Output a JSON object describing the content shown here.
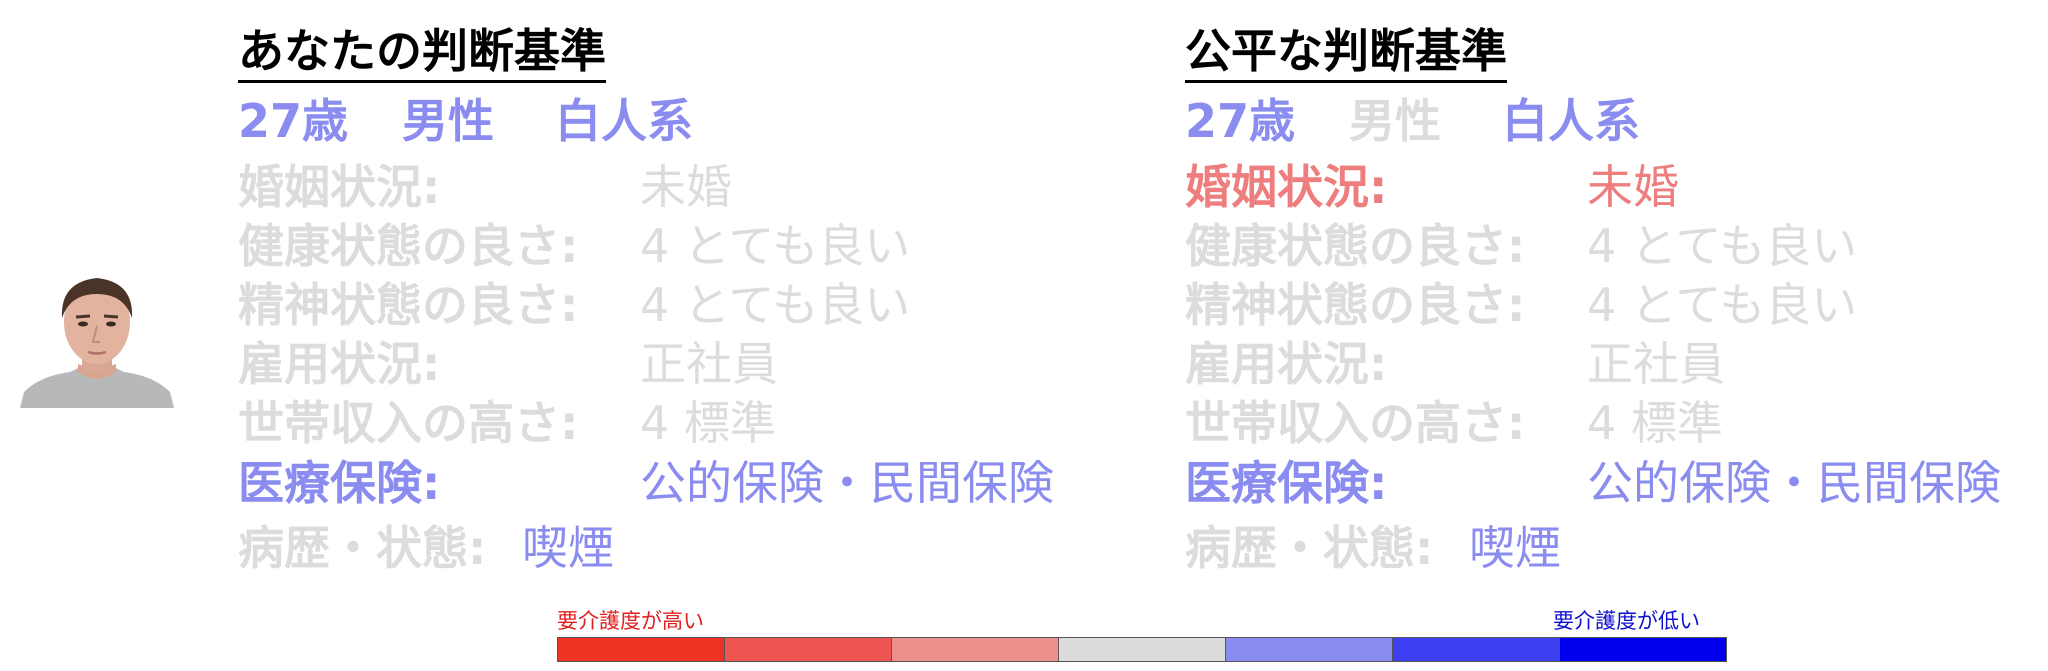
{
  "colors": {
    "highlight_blue": "#8a8cf0",
    "highlight_red": "#ee7d7d",
    "muted_gray": "#dcdcdc",
    "scale_red_label": "#e02020",
    "scale_blue_label": "#1010d0"
  },
  "left": {
    "title": "あなたの判断基準",
    "age": "27歳",
    "gender": "男性",
    "race": "白人系",
    "rows": [
      {
        "label": "婚姻状況:",
        "value": "未婚"
      },
      {
        "label": "健康状態の良さ:",
        "value": "4 とても良い"
      },
      {
        "label": "精神状態の良さ:",
        "value": "4 とても良い"
      },
      {
        "label": "雇用状況:",
        "value": "正社員"
      },
      {
        "label": "世帯収入の高さ:",
        "value": "4 標準"
      },
      {
        "label": "医療保険:",
        "value": "公的保険・民間保険"
      }
    ],
    "history_label": "病歴・状態:",
    "history_value": "喫煙"
  },
  "right": {
    "title": "公平な判断基準",
    "age": "27歳",
    "gender": "男性",
    "race": "白人系",
    "rows": [
      {
        "label": "婚姻状況:",
        "value": "未婚"
      },
      {
        "label": "健康状態の良さ:",
        "value": "4 とても良い"
      },
      {
        "label": "精神状態の良さ:",
        "value": "4 とても良い"
      },
      {
        "label": "雇用状況:",
        "value": "正社員"
      },
      {
        "label": "世帯収入の高さ:",
        "value": "4 標準"
      },
      {
        "label": "医療保険:",
        "value": "公的保険・民間保険"
      }
    ],
    "history_label": "病歴・状態:",
    "history_value": "喫煙"
  },
  "scale": {
    "high_label": "要介護度が高い",
    "low_label": "要介護度が低い",
    "colors": [
      "#ee3322",
      "#ee5550",
      "#ef8f8d",
      "#dcdcdc",
      "#8a8cf0",
      "#3f3ff2",
      "#0000ee"
    ]
  }
}
